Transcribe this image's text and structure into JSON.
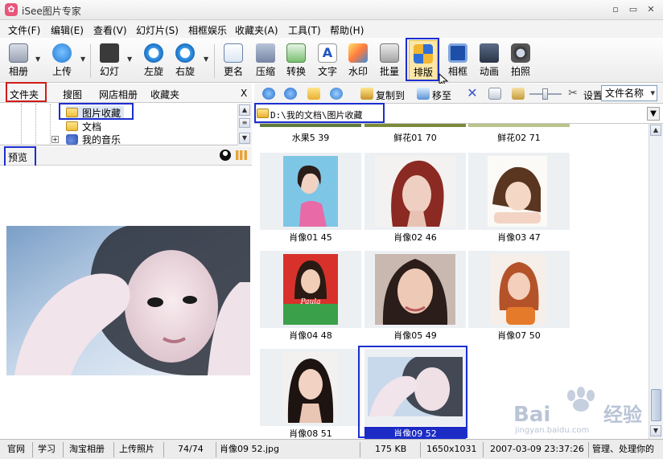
{
  "window": {
    "title": "iSee图片专家",
    "logo_glyph": "✿",
    "controls": {
      "minimize": "▫",
      "maximize": "▭",
      "close": "✕"
    }
  },
  "menu": [
    "文件(F)",
    "编辑(E)",
    "查看(V)",
    "幻灯片(S)",
    "相框娱乐",
    "收藏夹(A)",
    "工具(T)",
    "帮助(H)"
  ],
  "toolbar": {
    "album": "相册",
    "upload": "上传",
    "slideshow": "幻灯",
    "rotate_left": "左旋",
    "rotate_right": "右旋",
    "rename": "更名",
    "compress": "压缩",
    "convert": "转换",
    "text": "文字",
    "text_glyph": "A",
    "watermark": "水印",
    "batch": "批量",
    "layout": "排版",
    "frame": "相框",
    "animation": "动画",
    "photo": "拍照"
  },
  "left_tabs": {
    "folders": "文件夹",
    "search": "搜图",
    "shop_album": "网店相册",
    "favorites": "收藏夹",
    "close": "X"
  },
  "tree": {
    "items": [
      {
        "label": "图片收藏",
        "icon": "folder-icon"
      },
      {
        "label": "文档",
        "icon": "folder-icon"
      },
      {
        "label": "我的音乐",
        "icon": "music-icon"
      }
    ],
    "expander": "+"
  },
  "preview": {
    "title": "预览"
  },
  "right_toolbar": {
    "copy_to": "复制到",
    "move_to": "移至",
    "settings": "设置",
    "sort": "文件名称"
  },
  "address": {
    "path": "D:\\我的文档\\图片收藏"
  },
  "top_row": [
    "水果5 39",
    "鲜花01 70",
    "鲜花02 71"
  ],
  "thumbnails": [
    {
      "label": "肖像01 45",
      "selected": false
    },
    {
      "label": "肖像02 46",
      "selected": false
    },
    {
      "label": "肖像03 47",
      "selected": false
    },
    {
      "label": "肖像04 48",
      "selected": false
    },
    {
      "label": "肖像05 49",
      "selected": false
    },
    {
      "label": "肖像07 50",
      "selected": false
    },
    {
      "label": "肖像08 51",
      "selected": false
    },
    {
      "label": "肖像09 52",
      "selected": true
    }
  ],
  "thumb_text": {
    "paula": "Paula"
  },
  "status": {
    "official": "官网",
    "learn": "学习",
    "taobao": "淘宝相册",
    "upload": "上传照片",
    "count": "74/74",
    "filename": "肖像09 52.jpg",
    "size": "175 KB",
    "dimensions": "1650x1031",
    "datetime": "2007-03-09 23:37:26",
    "hint": "管理、处理你的"
  },
  "watermark": {
    "brand": "Bai",
    "brand_cn": "经验",
    "url": "jingyan.baidu.com"
  },
  "colors": {
    "highlight_box": "#1c2ed0",
    "active_tab_box": "#d01c1c",
    "selection": "#1b2bc4"
  }
}
